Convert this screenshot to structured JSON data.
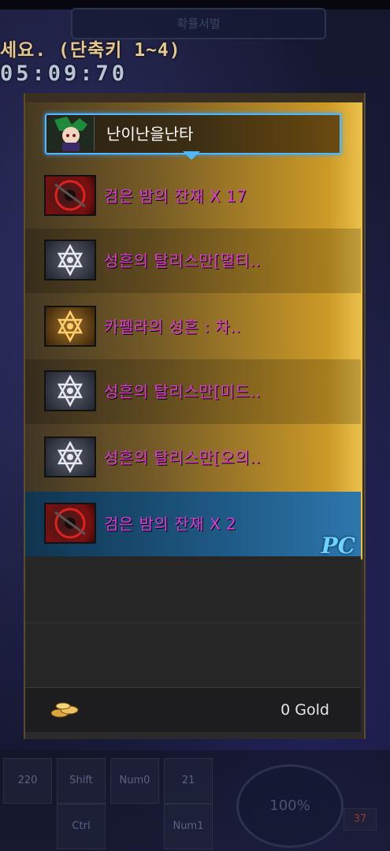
{
  "header": {
    "top_tab": "확률서벌",
    "instruction": "세요. (단축키 1~4)",
    "timer": "05:09:70"
  },
  "owner": {
    "name": "난이난을난타"
  },
  "items": [
    {
      "name": "검은 밤의 잔재 X 17",
      "icon": "black-night-remnant-icon"
    },
    {
      "name": "성흔의 탈리스만[멀티..",
      "icon": "silver-hexagram-talisman-icon"
    },
    {
      "name": "카펠라의 성흔 : 차..",
      "icon": "gold-hexagram-stigma-icon"
    },
    {
      "name": "성흔의 탈리스만[미드..",
      "icon": "silver-hexagram-talisman-icon"
    },
    {
      "name": "성흔의 탈리스만[오의..",
      "icon": "silver-hexagram-talisman-icon"
    },
    {
      "name": "검은 밤의 잔재 X 2",
      "icon": "black-night-remnant-icon"
    }
  ],
  "selected_index": 5,
  "pc_badge": "PC",
  "gold": {
    "amount_text": "0 Gold"
  },
  "hotbar": {
    "slots": [
      "220",
      "Shift",
      "Num0",
      "21",
      "Ctrl",
      "Num1"
    ],
    "gauge": "100%",
    "level": "37"
  },
  "colors": {
    "item_name": "#e239d9",
    "selected_row": "#2d77ad",
    "owner_border": "#4fb8ff",
    "pc_badge": "#6dd3ff"
  }
}
